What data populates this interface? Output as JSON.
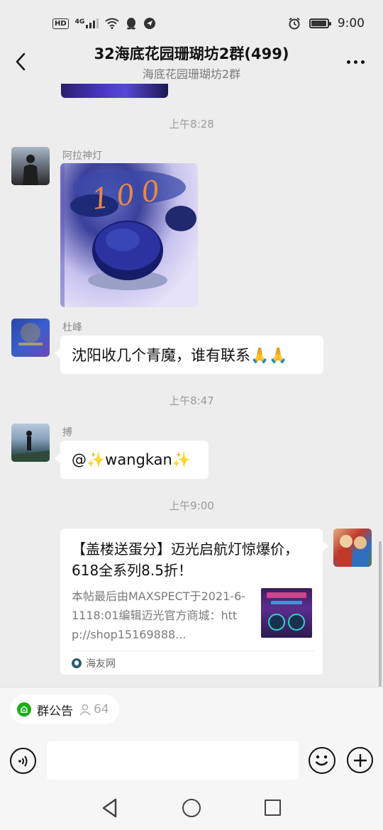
{
  "status_bar": {
    "hd": "HD",
    "network": "4G",
    "time": "9:00"
  },
  "nav": {
    "title": "32海底花园珊瑚坊2群(499)",
    "subtitle": "海底花园珊瑚坊2群"
  },
  "chat": {
    "messages": [
      {
        "type": "timestamp",
        "text": "上午8:28"
      },
      {
        "type": "image",
        "sender": "阿拉神灯",
        "image_text": "100"
      },
      {
        "type": "text",
        "sender": "杜峰",
        "text": "沈阳收几个青魔，谁有联系🙏🙏"
      },
      {
        "type": "timestamp",
        "text": "上午8:47"
      },
      {
        "type": "text",
        "sender": "搏",
        "text": "@✨wangkan✨"
      },
      {
        "type": "timestamp",
        "text": "上午9:00"
      },
      {
        "type": "link_card",
        "sender": "me",
        "title": "【盖楼送蛋分】迈光启航灯惊爆价，618全系列8.5折！",
        "description": "本帖最后由MAXSPECT于2021-6-1118:01编辑迈光官方商城：http://shop15169888...",
        "source": "海友网"
      }
    ]
  },
  "bottom": {
    "notice_label": "群公告",
    "member_count": "64",
    "input_placeholder": ""
  }
}
